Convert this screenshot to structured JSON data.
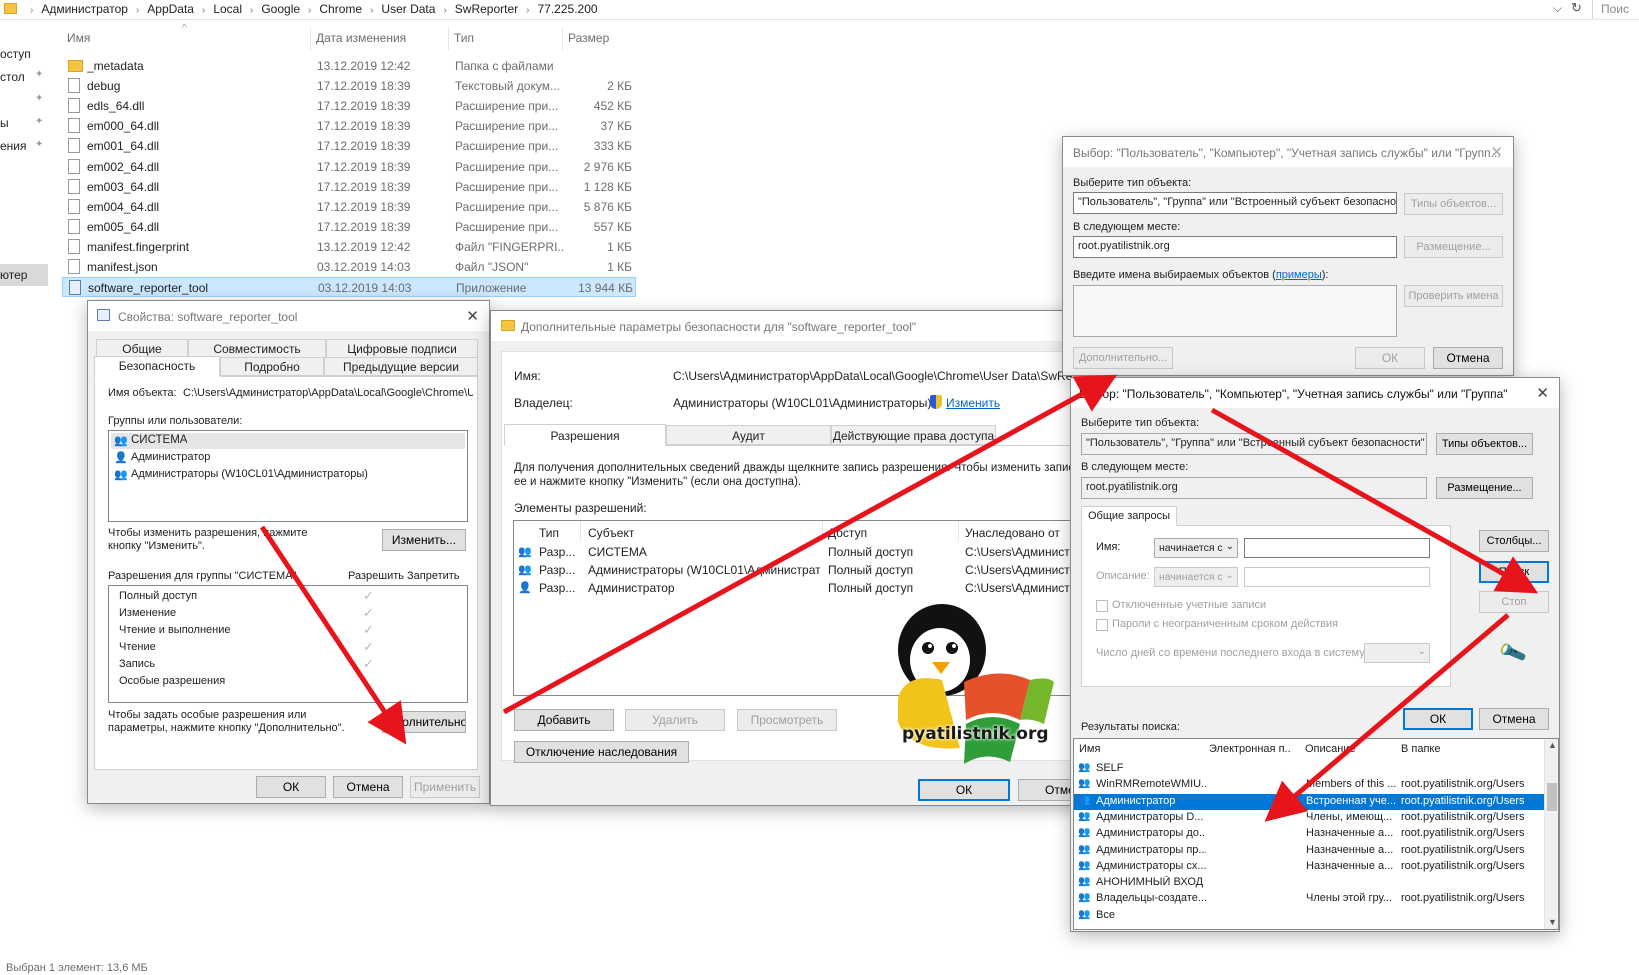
{
  "explorer": {
    "breadcrumb": [
      "Администратор",
      "AppData",
      "Local",
      "Google",
      "Chrome",
      "User Data",
      "SwReporter",
      "77.225.200"
    ],
    "search_placeholder": "Поис",
    "nav_items": [
      "оступ",
      "стол",
      "ы",
      "ения",
      "ютер"
    ],
    "columns": {
      "name": "Имя",
      "date": "Дата изменения",
      "type": "Тип",
      "size": "Размер"
    },
    "files": [
      {
        "name": "_metadata",
        "date": "13.12.2019 12:42",
        "type": "Папка с файлами",
        "size": "",
        "icon": "folder"
      },
      {
        "name": "debug",
        "date": "17.12.2019 18:39",
        "type": "Текстовый докум...",
        "size": "2 КБ",
        "icon": "text"
      },
      {
        "name": "edls_64.dll",
        "date": "17.12.2019 18:39",
        "type": "Расширение при...",
        "size": "452 КБ",
        "icon": "dll"
      },
      {
        "name": "em000_64.dll",
        "date": "17.12.2019 18:39",
        "type": "Расширение при...",
        "size": "37 КБ",
        "icon": "dll"
      },
      {
        "name": "em001_64.dll",
        "date": "17.12.2019 18:39",
        "type": "Расширение при...",
        "size": "333 КБ",
        "icon": "dll"
      },
      {
        "name": "em002_64.dll",
        "date": "17.12.2019 18:39",
        "type": "Расширение при...",
        "size": "2 976 КБ",
        "icon": "dll"
      },
      {
        "name": "em003_64.dll",
        "date": "17.12.2019 18:39",
        "type": "Расширение при...",
        "size": "1 128 КБ",
        "icon": "dll"
      },
      {
        "name": "em004_64.dll",
        "date": "17.12.2019 18:39",
        "type": "Расширение при...",
        "size": "5 876 КБ",
        "icon": "dll"
      },
      {
        "name": "em005_64.dll",
        "date": "17.12.2019 18:39",
        "type": "Расширение при...",
        "size": "557 КБ",
        "icon": "dll"
      },
      {
        "name": "manifest.fingerprint",
        "date": "13.12.2019 12:42",
        "type": "Файл \"FINGERPRI...",
        "size": "1 КБ",
        "icon": "file"
      },
      {
        "name": "manifest.json",
        "date": "03.12.2019 14:03",
        "type": "Файл \"JSON\"",
        "size": "1 КБ",
        "icon": "file"
      },
      {
        "name": "software_reporter_tool",
        "date": "03.12.2019 14:03",
        "type": "Приложение",
        "size": "13 944 КБ",
        "icon": "app",
        "selected": true
      }
    ],
    "status": "Выбран 1 элемент: 13,6 МБ"
  },
  "props": {
    "title": "Свойства: software_reporter_tool",
    "tabs_row1": [
      "Общие",
      "Совместимость",
      "Цифровые подписи"
    ],
    "tabs_row2": [
      "Безопасность",
      "Подробно",
      "Предыдущие версии"
    ],
    "object_label": "Имя объекта:",
    "object_value": "C:\\Users\\Администратор\\AppData\\Local\\Google\\Chrome\\U",
    "groups_label": "Группы или пользователи:",
    "groups": [
      "СИСТЕМА",
      "Администратор",
      "Администраторы (W10CL01\\Администраторы)"
    ],
    "change_hint": "Чтобы изменить разрешения, нажмите кнопку \"Изменить\".",
    "change_btn": "Изменить...",
    "perm_label": "Разрешения для группы \"СИСТЕМА\"",
    "allow": "Разрешить",
    "deny": "Запретить",
    "perms": [
      "Полный доступ",
      "Изменение",
      "Чтение и выполнение",
      "Чтение",
      "Запись",
      "Особые разрешения"
    ],
    "adv_hint": "Чтобы задать особые разрешения или параметры, нажмите кнопку \"Дополнительно\".",
    "adv_btn": "Дополнительно",
    "ok": "ОК",
    "cancel": "Отмена",
    "apply": "Применить"
  },
  "adv": {
    "title": "Дополнительные параметры безопасности  для \"software_reporter_tool\"",
    "name_label": "Имя:",
    "name_value": "C:\\Users\\Администратор\\AppData\\Local\\Google\\Chrome\\User Data\\SwRe",
    "owner_label": "Владелец:",
    "owner_value": "Администраторы (W10CL01\\Администраторы)",
    "owner_change": "Изменить",
    "tabs": [
      "Разрешения",
      "Аудит",
      "Действующие права доступа"
    ],
    "info": "Для получения дополнительных сведений дважды щелкните запись разрешения. Чтобы изменить запис",
    "info2": "ее и нажмите кнопку \"Изменить\" (если она доступна).",
    "entries_label": "Элементы разрешений:",
    "cols": [
      "Тип",
      "Субъект",
      "Доступ",
      "Унаследовано от"
    ],
    "rows": [
      {
        "type": "Разр...",
        "subject": "СИСТЕМА",
        "access": "Полный доступ",
        "from": "C:\\Users\\Администра"
      },
      {
        "type": "Разр...",
        "subject": "Администраторы (W10CL01\\Администрат...",
        "access": "Полный доступ",
        "from": "C:\\Users\\Администра"
      },
      {
        "type": "Разр...",
        "subject": "Администратор",
        "access": "Полный доступ",
        "from": "C:\\Users\\Администра"
      }
    ],
    "add": "Добавить",
    "remove": "Удалить",
    "view": "Просмотреть",
    "disable_inherit": "Отключение наследования",
    "ok": "ОК",
    "cancel": "Отме"
  },
  "select1": {
    "title": "Выбор: \"Пользователь\", \"Компьютер\", \"Учетная запись службы\" или \"Групп...",
    "type_label": "Выберите тип объекта:",
    "type_value": "\"Пользователь\", \"Группа\" или \"Встроенный субъект безопаснос",
    "types_btn": "Типы объектов...",
    "loc_label": "В следующем месте:",
    "loc_value": "root.pyatilistnik.org",
    "loc_btn": "Размещение...",
    "names_label": "Введите имена выбираемых объектов (",
    "names_link": "примеры",
    "names_label_end": "):",
    "check_btn": "Проверить имена",
    "adv_btn": "Дополнительно...",
    "ok": "ОК",
    "cancel": "Отмена"
  },
  "select2": {
    "title": "Выбор: \"Пользователь\", \"Компьютер\", \"Учетная запись службы\" или \"Группа\"",
    "type_label": "Выберите тип объекта:",
    "type_value": "\"Пользователь\", \"Группа\" или \"Встроенный субъект безопасности\"",
    "types_btn": "Типы объектов...",
    "loc_label": "В следующем месте:",
    "loc_value": "root.pyatilistnik.org",
    "loc_btn": "Размещение...",
    "tab": "Общие запросы",
    "name_label": "Имя:",
    "name_mode": "начинается с",
    "desc_label": "Описание:",
    "desc_mode": "начинается с",
    "disabled_accounts": "Отключенные учетные записи",
    "no_expire": "Пароли с неограниченным сроком действия",
    "days_label": "Число дней со времени последнего входа в систему:",
    "columns_btn": "Столбцы...",
    "search_btn": "Поиск",
    "stop_btn": "Стоп",
    "ok": "ОК",
    "cancel": "Отмена",
    "results_label": "Результаты поиска:",
    "res_cols": [
      "Имя",
      "Электронная п...",
      "Описание",
      "В папке"
    ],
    "results": [
      {
        "name": "SELF",
        "desc": "",
        "folder": ""
      },
      {
        "name": "WinRMRemoteWMIU...",
        "desc": "Members of this ...",
        "folder": "root.pyatilistnik.org/Users"
      },
      {
        "name": "Администратор",
        "desc": "Встроенная уче...",
        "folder": "root.pyatilistnik.org/Users",
        "selected": true
      },
      {
        "name": "Администраторы D...",
        "desc": "Члены, имеющ...",
        "folder": "root.pyatilistnik.org/Users"
      },
      {
        "name": "Администраторы до...",
        "desc": "Назначенные а...",
        "folder": "root.pyatilistnik.org/Users"
      },
      {
        "name": "Администраторы пр...",
        "desc": "Назначенные а...",
        "folder": "root.pyatilistnik.org/Users"
      },
      {
        "name": "Администраторы сх...",
        "desc": "Назначенные а...",
        "folder": "root.pyatilistnik.org/Users"
      },
      {
        "name": "АНОНИМНЫЙ ВХОД",
        "desc": "",
        "folder": ""
      },
      {
        "name": "Владельцы-создате...",
        "desc": "Члены этой гру...",
        "folder": "root.pyatilistnik.org/Users"
      },
      {
        "name": "Все",
        "desc": "",
        "folder": ""
      }
    ]
  },
  "watermark": "pyatilistnik.org",
  "colors": {
    "arrow": "#e8141b",
    "selection": "#0078d7",
    "link": "#0066cc",
    "file_selected": "#cce8ff"
  }
}
